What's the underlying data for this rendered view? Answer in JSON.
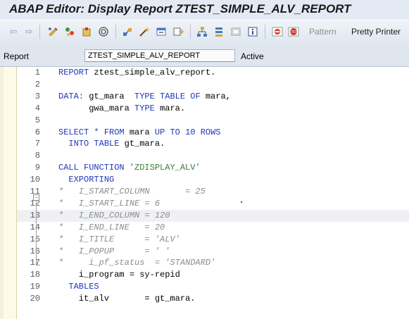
{
  "window": {
    "title": "ABAP Editor: Display Report ZTEST_SIMPLE_ALV_REPORT"
  },
  "toolbar": {
    "pattern_label": "Pattern",
    "pretty_printer_label": "Pretty Printer"
  },
  "fields": {
    "report_label": "Report",
    "report_value": "ZTEST_SIMPLE_ALV_REPORT",
    "status": "Active"
  },
  "code_lines": [
    {
      "n": "1",
      "segs": [
        {
          "t": "REPORT",
          "c": "kw"
        },
        {
          "t": " ztest_simple_alv_report.",
          "c": ""
        }
      ]
    },
    {
      "n": "2",
      "segs": []
    },
    {
      "n": "3",
      "segs": [
        {
          "t": "DATA:",
          "c": "kw"
        },
        {
          "t": " gt_mara  ",
          "c": ""
        },
        {
          "t": "TYPE TABLE OF",
          "c": "kw"
        },
        {
          "t": " mara,",
          "c": ""
        }
      ]
    },
    {
      "n": "4",
      "segs": [
        {
          "t": "      gwa_mara ",
          "c": ""
        },
        {
          "t": "TYPE",
          "c": "kw"
        },
        {
          "t": " mara.",
          "c": ""
        }
      ]
    },
    {
      "n": "5",
      "segs": []
    },
    {
      "n": "6",
      "segs": [
        {
          "t": "SELECT",
          "c": "kw"
        },
        {
          "t": " ",
          "c": ""
        },
        {
          "t": "*",
          "c": "kw"
        },
        {
          "t": " ",
          "c": ""
        },
        {
          "t": "FROM",
          "c": "kw"
        },
        {
          "t": " mara ",
          "c": ""
        },
        {
          "t": "UP TO",
          "c": "kw"
        },
        {
          "t": " ",
          "c": ""
        },
        {
          "t": "10",
          "c": "nm"
        },
        {
          "t": " ",
          "c": ""
        },
        {
          "t": "ROWS",
          "c": "kw"
        }
      ]
    },
    {
      "n": "7",
      "segs": [
        {
          "t": "  ",
          "c": ""
        },
        {
          "t": "INTO TABLE",
          "c": "kw"
        },
        {
          "t": " gt_mara.",
          "c": ""
        }
      ]
    },
    {
      "n": "8",
      "segs": []
    },
    {
      "n": "9",
      "segs": [
        {
          "t": "CALL FUNCTION",
          "c": "kw"
        },
        {
          "t": " ",
          "c": ""
        },
        {
          "t": "'ZDISPLAY_ALV'",
          "c": "st"
        }
      ]
    },
    {
      "n": "10",
      "segs": [
        {
          "t": "  ",
          "c": ""
        },
        {
          "t": "EXPORTING",
          "c": "kw"
        }
      ]
    },
    {
      "n": "11",
      "segs": [
        {
          "t": "*   I_START_COLUMN       = 25",
          "c": "cm"
        }
      ]
    },
    {
      "n": "12",
      "segs": [
        {
          "t": "*   I_START_LINE = 6",
          "c": "cm"
        }
      ]
    },
    {
      "n": "13",
      "segs": [
        {
          "t": "*   I_END_COLUMN = 120",
          "c": "cm"
        }
      ]
    },
    {
      "n": "14",
      "segs": [
        {
          "t": "*   I_END_LINE   = 20",
          "c": "cm"
        }
      ]
    },
    {
      "n": "15",
      "segs": [
        {
          "t": "*   I_TITLE      = 'ALV'",
          "c": "cm"
        }
      ]
    },
    {
      "n": "16",
      "segs": [
        {
          "t": "*   I_POPUP      = ' '",
          "c": "cm"
        }
      ]
    },
    {
      "n": "17",
      "segs": [
        {
          "t": "*     i_pf_status  = 'STANDARD'",
          "c": "cm"
        }
      ]
    },
    {
      "n": "18",
      "segs": [
        {
          "t": "    i_program = sy-repid",
          "c": ""
        }
      ]
    },
    {
      "n": "19",
      "segs": [
        {
          "t": "  ",
          "c": ""
        },
        {
          "t": "TABLES",
          "c": "kw"
        }
      ]
    },
    {
      "n": "20",
      "segs": [
        {
          "t": "    it_alv       = gt_mara.",
          "c": ""
        }
      ]
    }
  ],
  "highlighted_line": "13"
}
